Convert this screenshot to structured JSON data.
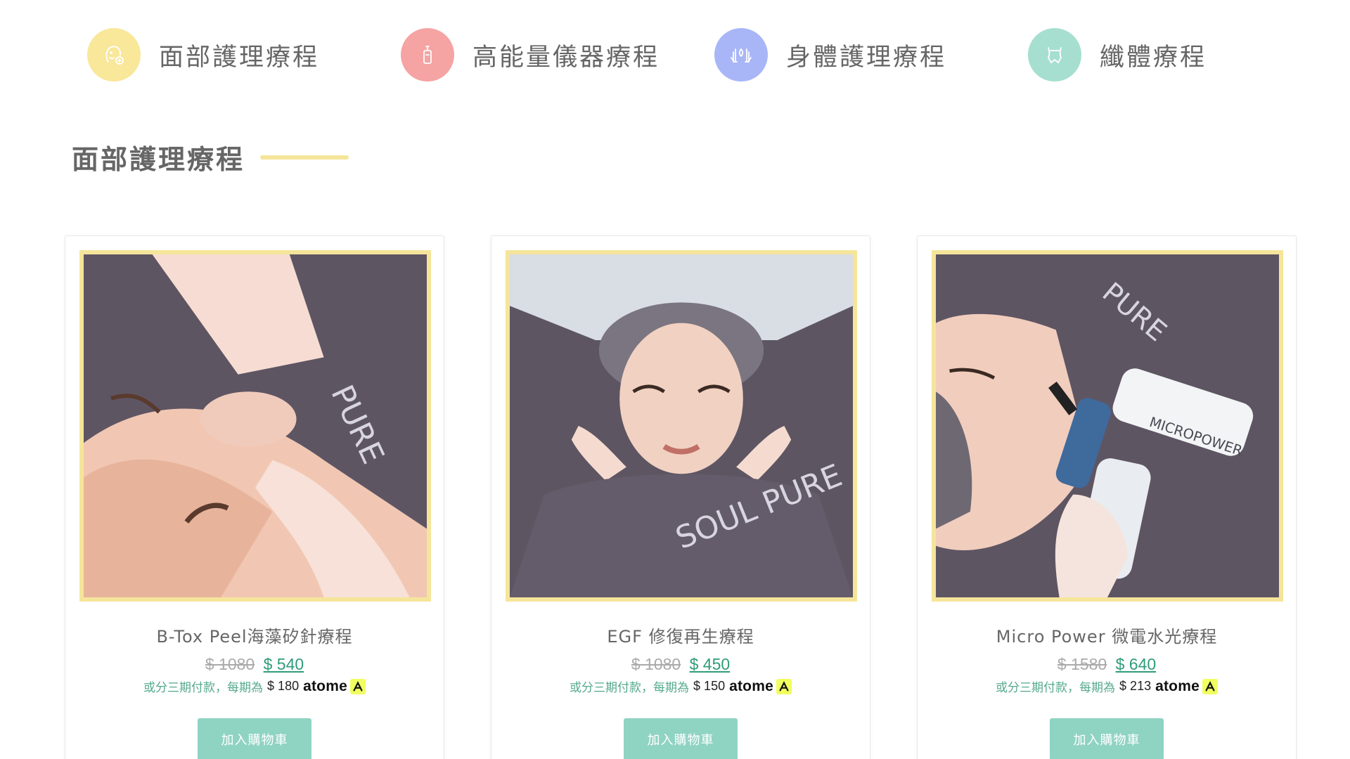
{
  "categories": [
    {
      "label": "面部護理療程",
      "icon": "face-care-icon",
      "color": "#f9e79a"
    },
    {
      "label": "高能量儀器療程",
      "icon": "device-icon",
      "color": "#f5a3a3"
    },
    {
      "label": "身體護理療程",
      "icon": "hands-icon",
      "color": "#a8b6f7"
    },
    {
      "label": "纖體療程",
      "icon": "body-icon",
      "color": "#a6dfcf"
    }
  ],
  "section": {
    "title": "面部護理療程",
    "accent_color": "#f5e59a"
  },
  "products": [
    {
      "title": "B-Tox Peel海藻矽針療程",
      "old_price": "$ 1080",
      "new_price": "$ 540",
      "installment_text": "或分三期付款，每期為",
      "installment_amount": "$ 180",
      "atome": "atome",
      "button": "加入購物車",
      "image": "facial-peel-treatment-photo"
    },
    {
      "title": "EGF 修復再生療程",
      "old_price": "$ 1080",
      "new_price": "$ 450",
      "installment_text": "或分三期付款，每期為",
      "installment_amount": "$ 150",
      "atome": "atome",
      "button": "加入購物車",
      "image": "facial-massage-photo"
    },
    {
      "title": "Micro Power 微電水光療程",
      "old_price": "$ 1580",
      "new_price": "$ 640",
      "installment_text": "或分三期付款，每期為",
      "installment_amount": "$ 213",
      "atome": "atome",
      "button": "加入購物車",
      "image": "micropower-device-photo"
    }
  ],
  "colors": {
    "price_green": "#2f9c7a",
    "button_teal": "#8fd3c3",
    "image_border": "#f5e59a",
    "atome_yellow": "#f0ff5f"
  }
}
